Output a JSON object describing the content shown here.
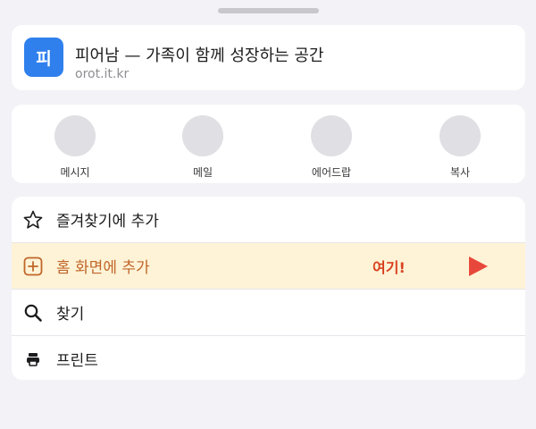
{
  "site": {
    "icon_text": "피",
    "title": "피어남 — 가족이 함께 성장하는 공간",
    "url": "orot.it.kr"
  },
  "share_targets": [
    {
      "label": "메시지",
      "icon": "messages-app-icon"
    },
    {
      "label": "메일",
      "icon": "mail-app-icon"
    },
    {
      "label": "에어드랍",
      "icon": "airdrop-icon"
    },
    {
      "label": "복사",
      "icon": "copy-icon"
    }
  ],
  "actions": [
    {
      "label": "즐겨찾기에 추가",
      "icon": "star-icon",
      "highlighted": false
    },
    {
      "label": "홈 화면에 추가",
      "icon": "add-square-icon",
      "highlighted": true
    },
    {
      "label": "찾기",
      "icon": "search-icon",
      "highlighted": false
    },
    {
      "label": "프린트",
      "icon": "printer-icon",
      "highlighted": false
    }
  ],
  "callout": {
    "text": "여기!",
    "arrow_icon": "play-arrow-icon"
  },
  "colors": {
    "site_icon_bg": "#2f80ed",
    "highlight_bg": "#fef3d6",
    "highlight_text": "#c0662a",
    "callout": "#d9401f",
    "sheet_bg": "#f2f2f7"
  }
}
